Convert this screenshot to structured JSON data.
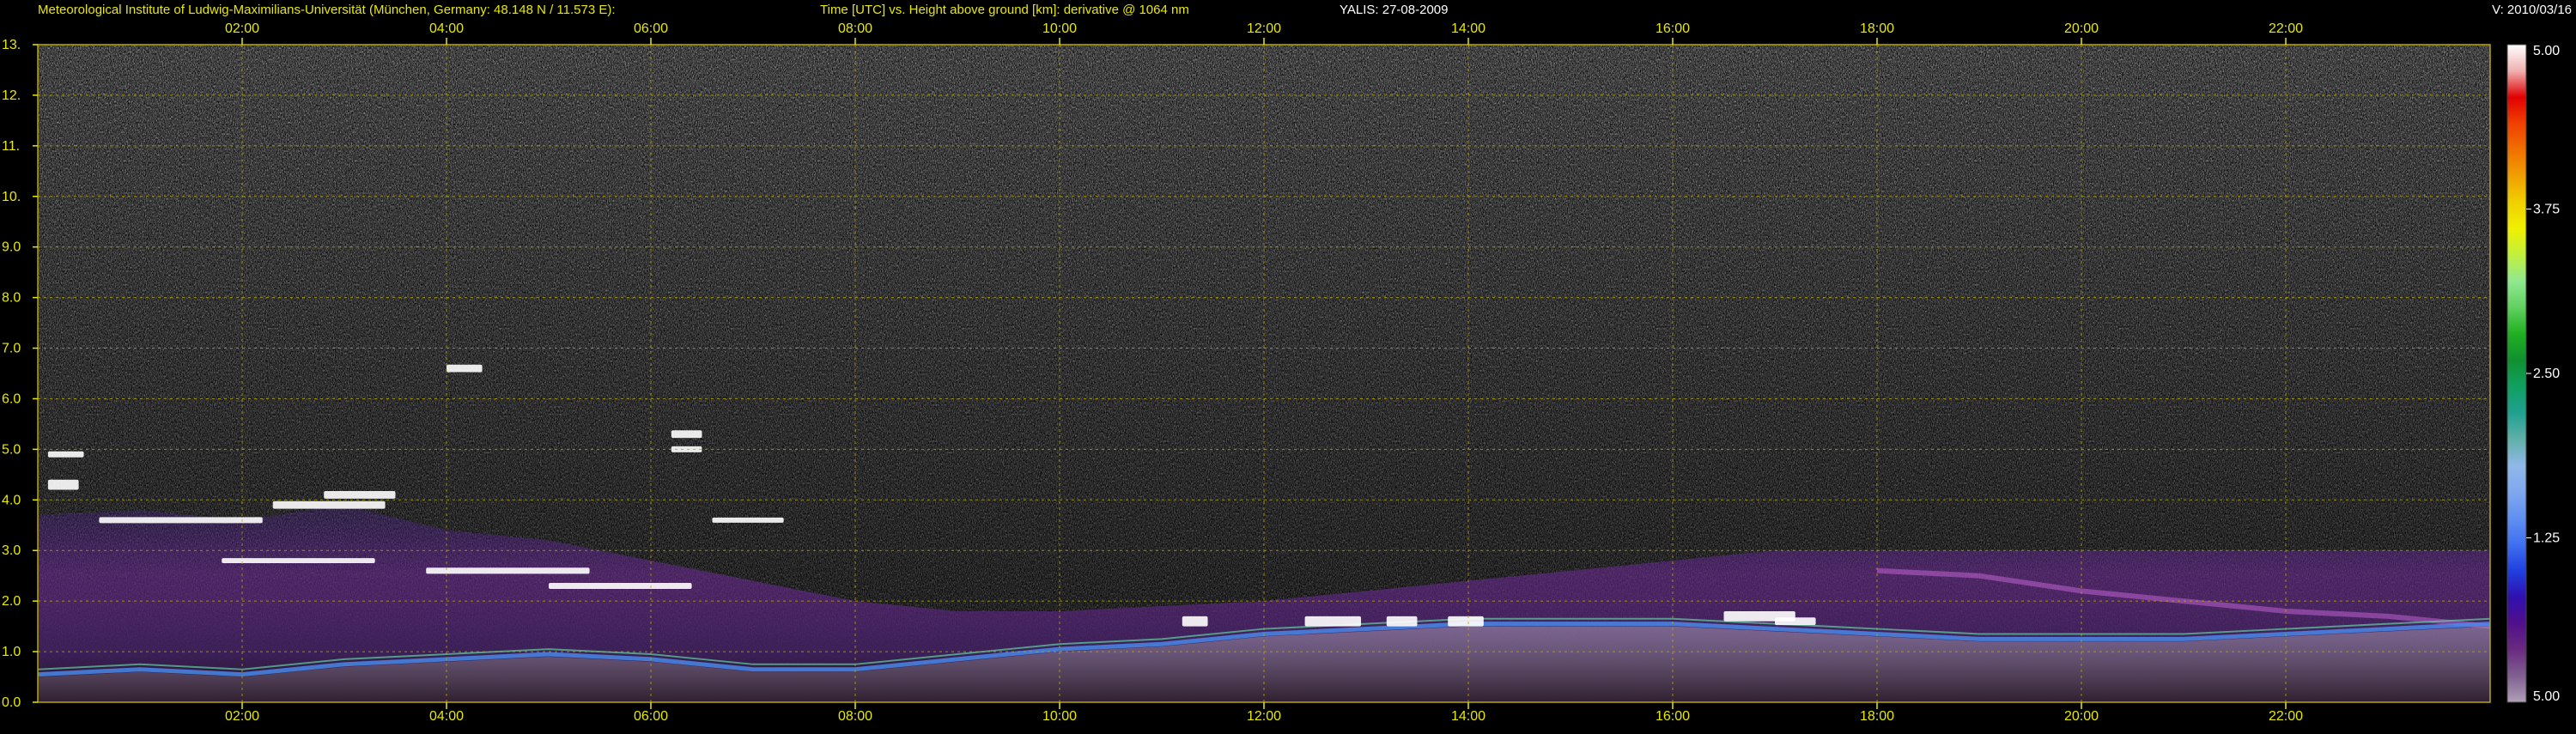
{
  "header": {
    "institute": "Meteorological Institute of Ludwig-Maximilians-Universität (München, Germany: 48.148 N / 11.573 E):",
    "plot_description": "Time [UTC] vs. Height above ground [km]: derivative @ 1064 nm",
    "instrument_date": "YALIS: 27-08-2009",
    "version": "V: 2010/03/16"
  },
  "colors": {
    "text": "#e8e800",
    "grid": "#b8a800",
    "background": "#000000",
    "white_text": "#ffffff"
  },
  "chart_data": {
    "type": "heatmap",
    "title": "Time [UTC] vs. Height above ground [km]: derivative @ 1064 nm",
    "x_unit": "hours UTC",
    "y_unit": "km",
    "xlim": [
      0,
      24
    ],
    "ylim": [
      0,
      13
    ],
    "x_ticks": [
      2,
      4,
      6,
      8,
      10,
      12,
      14,
      16,
      18,
      20,
      22
    ],
    "x_tick_labels": [
      "02:00",
      "04:00",
      "06:00",
      "08:00",
      "10:00",
      "12:00",
      "14:00",
      "16:00",
      "18:00",
      "20:00",
      "22:00"
    ],
    "y_ticks": [
      0,
      1,
      2,
      3,
      4,
      5,
      6,
      7,
      8,
      9,
      10,
      11,
      12,
      13
    ],
    "y_tick_labels": [
      "0.0",
      "1.0",
      "2.0",
      "3.0",
      "4.0",
      "5.0",
      "6.0",
      "7.0",
      "8.0",
      "9.0",
      "10.",
      "11.",
      "12.",
      "13."
    ],
    "grid": true,
    "colorbar": {
      "position": "right",
      "tick_values": [
        1.25,
        2.5,
        3.75
      ],
      "tick_labels": [
        "5.00",
        "1.25",
        "2.50",
        "3.75",
        "5.00"
      ],
      "label_values": [
        0,
        1.25,
        2.5,
        3.75,
        5
      ],
      "range": [
        0,
        5
      ],
      "stops": [
        "#b0a0b8",
        "#806090",
        "#6a2a80",
        "#50108a",
        "#3010b0",
        "#2040e0",
        "#4070f0",
        "#6090f0",
        "#80a8f0",
        "#90b8e8",
        "#60b0a8",
        "#20a090",
        "#10a060",
        "#109030",
        "#20b020",
        "#60d060",
        "#90e890",
        "#c0f040",
        "#f0f000",
        "#f0d000",
        "#f0a000",
        "#f07000",
        "#f04000",
        "#e00000",
        "#f0b0b0",
        "#ffffff"
      ]
    },
    "aerosol_layer_top_km": [
      [
        0.0,
        3.7
      ],
      [
        1.0,
        3.8
      ],
      [
        2.0,
        3.6
      ],
      [
        3.0,
        3.9
      ],
      [
        4.0,
        3.4
      ],
      [
        5.0,
        3.2
      ],
      [
        6.0,
        2.8
      ],
      [
        7.0,
        2.4
      ],
      [
        8.0,
        2.0
      ],
      [
        9.0,
        1.8
      ],
      [
        10.0,
        1.8
      ],
      [
        11.0,
        1.9
      ],
      [
        12.0,
        2.0
      ],
      [
        13.0,
        2.2
      ],
      [
        14.0,
        2.4
      ],
      [
        15.0,
        2.6
      ],
      [
        16.0,
        2.8
      ],
      [
        17.0,
        3.0
      ],
      [
        18.0,
        3.0
      ],
      [
        19.0,
        3.0
      ],
      [
        20.0,
        3.0
      ],
      [
        21.0,
        3.0
      ],
      [
        22.0,
        3.0
      ],
      [
        23.0,
        3.0
      ],
      [
        24.0,
        3.0
      ]
    ],
    "boundary_layer_km": [
      [
        0.0,
        0.5
      ],
      [
        1.0,
        0.6
      ],
      [
        2.0,
        0.5
      ],
      [
        3.0,
        0.7
      ],
      [
        4.0,
        0.8
      ],
      [
        5.0,
        0.9
      ],
      [
        6.0,
        0.8
      ],
      [
        7.0,
        0.6
      ],
      [
        8.0,
        0.6
      ],
      [
        9.0,
        0.8
      ],
      [
        10.0,
        1.0
      ],
      [
        11.0,
        1.1
      ],
      [
        12.0,
        1.3
      ],
      [
        13.0,
        1.4
      ],
      [
        14.0,
        1.5
      ],
      [
        15.0,
        1.5
      ],
      [
        16.0,
        1.5
      ],
      [
        17.0,
        1.4
      ],
      [
        18.0,
        1.3
      ],
      [
        19.0,
        1.2
      ],
      [
        20.0,
        1.2
      ],
      [
        21.0,
        1.2
      ],
      [
        22.0,
        1.3
      ],
      [
        23.0,
        1.4
      ],
      [
        24.0,
        1.5
      ]
    ],
    "residual_layer_km": [
      [
        18.0,
        2.6
      ],
      [
        19.0,
        2.5
      ],
      [
        20.0,
        2.2
      ],
      [
        21.0,
        2.0
      ],
      [
        22.0,
        1.8
      ],
      [
        23.0,
        1.7
      ],
      [
        24.0,
        1.5
      ]
    ],
    "cloud_features": [
      {
        "t": 0.1,
        "h": 4.9,
        "dt": 0.35,
        "dh": 0.12
      },
      {
        "t": 0.1,
        "h": 4.3,
        "dt": 0.3,
        "dh": 0.2
      },
      {
        "t": 0.6,
        "h": 3.6,
        "dt": 1.6,
        "dh": 0.12
      },
      {
        "t": 2.3,
        "h": 3.9,
        "dt": 1.1,
        "dh": 0.15
      },
      {
        "t": 2.8,
        "h": 4.1,
        "dt": 0.7,
        "dh": 0.15
      },
      {
        "t": 1.8,
        "h": 2.8,
        "dt": 1.5,
        "dh": 0.1
      },
      {
        "t": 3.8,
        "h": 2.6,
        "dt": 1.6,
        "dh": 0.12
      },
      {
        "t": 5.0,
        "h": 2.3,
        "dt": 1.4,
        "dh": 0.12
      },
      {
        "t": 6.6,
        "h": 3.6,
        "dt": 0.7,
        "dh": 0.1
      },
      {
        "t": 4.0,
        "h": 6.6,
        "dt": 0.35,
        "dh": 0.15
      },
      {
        "t": 6.2,
        "h": 5.3,
        "dt": 0.3,
        "dh": 0.15
      },
      {
        "t": 6.2,
        "h": 5.0,
        "dt": 0.3,
        "dh": 0.12
      },
      {
        "t": 11.2,
        "h": 1.6,
        "dt": 0.25,
        "dh": 0.2
      },
      {
        "t": 12.4,
        "h": 1.6,
        "dt": 0.55,
        "dh": 0.2
      },
      {
        "t": 13.2,
        "h": 1.6,
        "dt": 0.3,
        "dh": 0.2
      },
      {
        "t": 13.8,
        "h": 1.6,
        "dt": 0.35,
        "dh": 0.2
      },
      {
        "t": 16.5,
        "h": 1.7,
        "dt": 0.7,
        "dh": 0.2
      },
      {
        "t": 17.0,
        "h": 1.6,
        "dt": 0.4,
        "dh": 0.15
      }
    ]
  }
}
